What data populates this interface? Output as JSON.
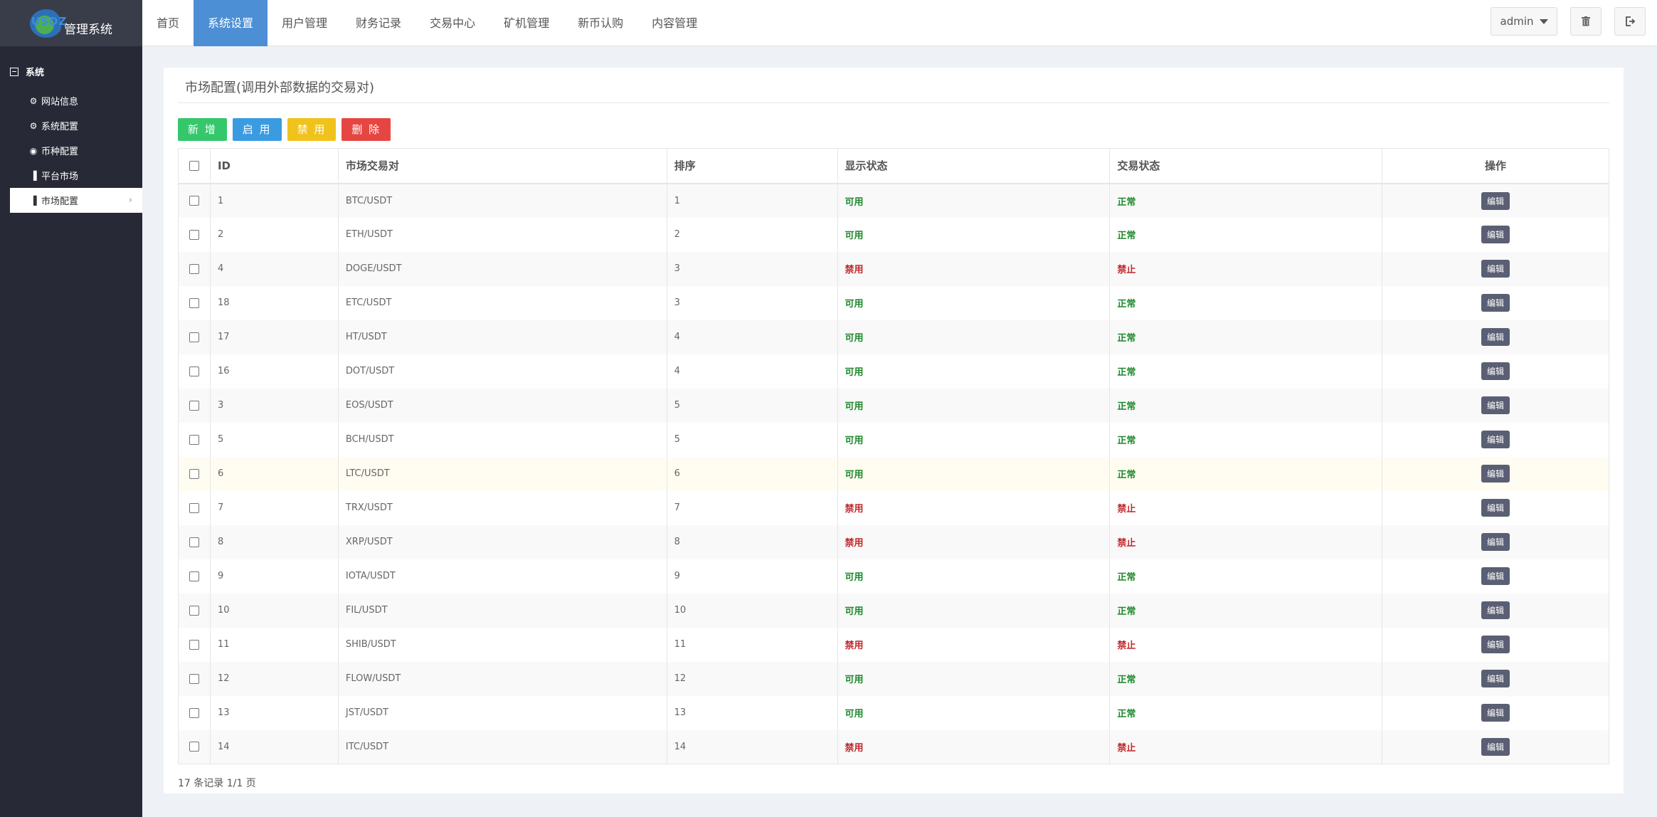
{
  "logo": {
    "mark_text": "USDZ",
    "title": "管理系统"
  },
  "sidebar": {
    "group": "系统",
    "items": [
      {
        "label": "网站信息",
        "icon": "gear-icon"
      },
      {
        "label": "系统配置",
        "icon": "gear-icon"
      },
      {
        "label": "币种配置",
        "icon": "circle-icon"
      },
      {
        "label": "平台市场",
        "icon": "bar-chart-icon"
      },
      {
        "label": "市场配置",
        "icon": "bar-chart-icon",
        "active": true
      }
    ]
  },
  "topnav": {
    "items": [
      "首页",
      "系统设置",
      "用户管理",
      "财务记录",
      "交易中心",
      "矿机管理",
      "新币认购",
      "内容管理"
    ],
    "active_index": 1,
    "user": "admin"
  },
  "panel": {
    "title": "市场配置(调用外部数据的交易对)",
    "buttons": {
      "add": "新 增",
      "enable": "启 用",
      "disable": "禁 用",
      "delete": "删 除"
    },
    "columns": [
      "ID",
      "市场交易对",
      "排序",
      "显示状态",
      "交易状态",
      "操作"
    ],
    "edit_label": "编辑",
    "rows": [
      {
        "id": "1",
        "pair": "BTC/USDT",
        "sort": "1",
        "display": "可用",
        "trade": "正常"
      },
      {
        "id": "2",
        "pair": "ETH/USDT",
        "sort": "2",
        "display": "可用",
        "trade": "正常"
      },
      {
        "id": "4",
        "pair": "DOGE/USDT",
        "sort": "3",
        "display": "禁用",
        "trade": "禁止"
      },
      {
        "id": "18",
        "pair": "ETC/USDT",
        "sort": "3",
        "display": "可用",
        "trade": "正常"
      },
      {
        "id": "17",
        "pair": "HT/USDT",
        "sort": "4",
        "display": "可用",
        "trade": "正常"
      },
      {
        "id": "16",
        "pair": "DOT/USDT",
        "sort": "4",
        "display": "可用",
        "trade": "正常"
      },
      {
        "id": "3",
        "pair": "EOS/USDT",
        "sort": "5",
        "display": "可用",
        "trade": "正常"
      },
      {
        "id": "5",
        "pair": "BCH/USDT",
        "sort": "5",
        "display": "可用",
        "trade": "正常"
      },
      {
        "id": "6",
        "pair": "LTC/USDT",
        "sort": "6",
        "display": "可用",
        "trade": "正常"
      },
      {
        "id": "7",
        "pair": "TRX/USDT",
        "sort": "7",
        "display": "禁用",
        "trade": "禁止"
      },
      {
        "id": "8",
        "pair": "XRP/USDT",
        "sort": "8",
        "display": "禁用",
        "trade": "禁止"
      },
      {
        "id": "9",
        "pair": "IOTA/USDT",
        "sort": "9",
        "display": "可用",
        "trade": "正常"
      },
      {
        "id": "10",
        "pair": "FIL/USDT",
        "sort": "10",
        "display": "可用",
        "trade": "正常"
      },
      {
        "id": "11",
        "pair": "SHIB/USDT",
        "sort": "11",
        "display": "禁用",
        "trade": "禁止"
      },
      {
        "id": "12",
        "pair": "FLOW/USDT",
        "sort": "12",
        "display": "可用",
        "trade": "正常"
      },
      {
        "id": "13",
        "pair": "JST/USDT",
        "sort": "13",
        "display": "可用",
        "trade": "正常"
      },
      {
        "id": "14",
        "pair": "ITC/USDT",
        "sort": "14",
        "display": "禁用",
        "trade": "禁止"
      }
    ],
    "highlight_row": 8,
    "footer": "17 条记录 1/1 页"
  }
}
